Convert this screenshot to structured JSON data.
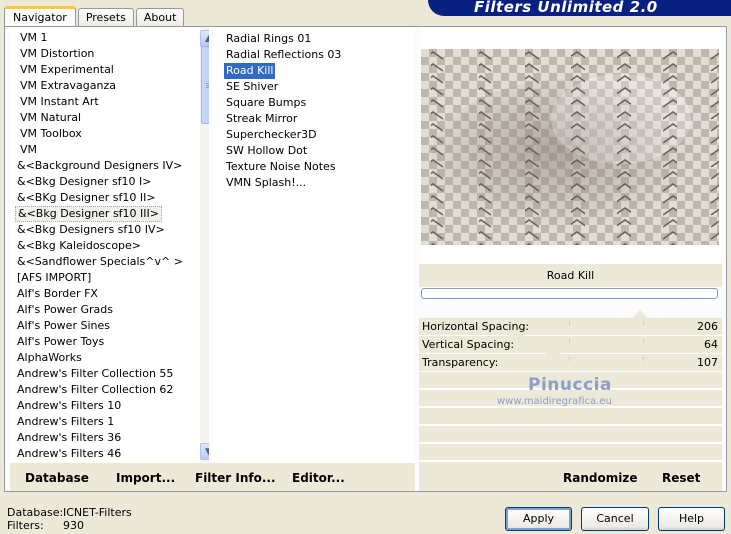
{
  "header": {
    "title": "Filters Unlimited 2.0",
    "tabs": [
      {
        "label": "Navigator",
        "active": true
      },
      {
        "label": "Presets",
        "active": false
      },
      {
        "label": "About",
        "active": false
      }
    ]
  },
  "categories": {
    "items": [
      "VM 1",
      "VM Distortion",
      "VM Experimental",
      "VM Extravaganza",
      "VM Instant Art",
      "VM Natural",
      "VM Toolbox",
      "VM",
      "&<Background Designers IV>",
      "&<Bkg Designer sf10 I>",
      "&<BKg Designer sf10 II>",
      "&<Bkg Designer sf10 III>",
      "&<Bkg Designers sf10 IV>",
      "&<Bkg Kaleidoscope>",
      "&<Sandflower Specials^v^ >",
      "[AFS IMPORT]",
      "Alf's Border FX",
      "Alf's Power Grads",
      "Alf's Power Sines",
      "Alf's Power Toys",
      "AlphaWorks",
      "Andrew's Filter Collection 55",
      "Andrew's Filter Collection 62",
      "Andrew's Filters 10",
      "Andrew's Filters 1",
      "Andrew's Filters 36",
      "Andrew's Filters 46"
    ],
    "selected_index": 11
  },
  "filters": {
    "items": [
      "Radial  Rings 01",
      "Radial Reflections 03",
      "Road Kill",
      "SE Shiver",
      "Square Bumps",
      "Streak Mirror",
      "Superchecker3D",
      "SW Hollow Dot",
      "Texture Noise Notes",
      "VMN Splash!..."
    ],
    "selected_index": 2
  },
  "preview": {
    "filter_name": "Road Kill",
    "progress": 0
  },
  "params": [
    {
      "label": "Horizontal Spacing:",
      "value": "206",
      "level": 0.81
    },
    {
      "label": "Vertical Spacing:",
      "value": "64",
      "level": 0.25
    },
    {
      "label": "Transparency:",
      "value": "107",
      "level": 0.42
    }
  ],
  "watermark": {
    "name": "Pinuccia",
    "site": "www.maidiregrafica.eu"
  },
  "left_buttons": {
    "database": "Database",
    "import": "Import...",
    "filter_info": "Filter Info...",
    "editor": "Editor..."
  },
  "right_buttons": {
    "randomize": "Randomize",
    "reset": "Reset"
  },
  "status": {
    "database_label": "Database:",
    "database_value": "ICNET-Filters",
    "filters_label": "Filters:",
    "filters_value": "930"
  },
  "dialog_buttons": {
    "apply": "Apply",
    "cancel": "Cancel",
    "help": "Help"
  }
}
